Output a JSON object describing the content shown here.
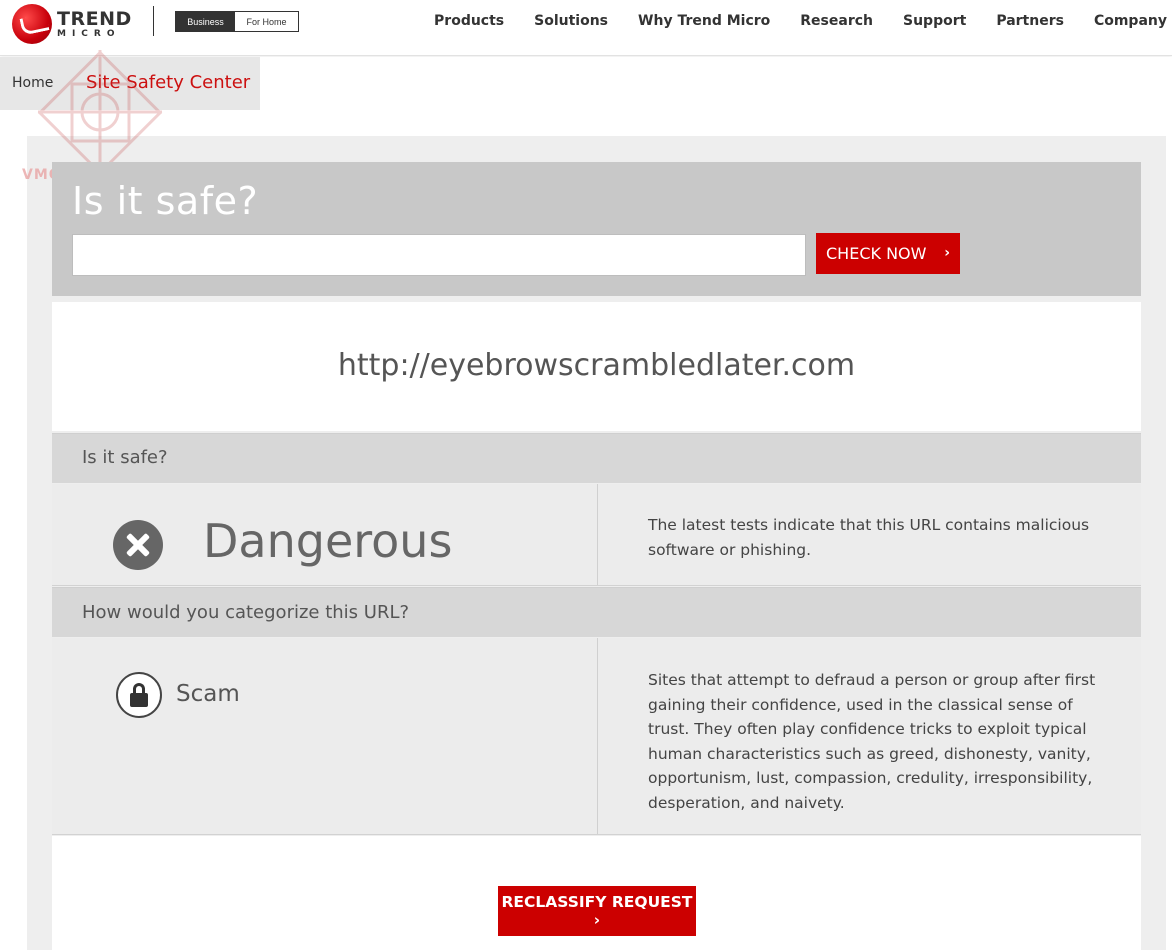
{
  "brand": {
    "word1": "TREND",
    "word2": "MICRO"
  },
  "segment": {
    "business": "Business",
    "home": "For Home"
  },
  "nav": [
    "Products",
    "Solutions",
    "Why Trend Micro",
    "Research",
    "Support",
    "Partners",
    "Company"
  ],
  "breadcrumb": {
    "home": "Home",
    "current": "Site Safety Center"
  },
  "watermark": "VMODTECH.COM",
  "search": {
    "title": "Is it safe?",
    "value": "",
    "button": "CHECK NOW",
    "button_icon": "chevron-right-icon"
  },
  "result": {
    "url": "http://eyebrowscrambledlater.com",
    "safety_header": "Is it safe?",
    "rating": "Dangerous",
    "rating_icon": "x-circle-icon",
    "rating_desc": "The latest tests indicate that this URL contains malicious software or phishing.",
    "category_header": "How would you categorize this URL?",
    "category": "Scam",
    "category_icon": "lock-icon",
    "category_desc": "Sites that attempt to defraud a person or group after first gaining their confidence, used in the classical sense of trust. They often play confidence tricks to exploit typical human characteristics such as greed, dishonesty, vanity, opportunism, lust, compassion, credulity, irresponsibility, desperation, and naivety."
  },
  "reclassify": {
    "label": "RECLASSIFY REQUEST",
    "chevron": "›"
  },
  "colors": {
    "accent": "#cc0000",
    "panel_gray": "#c8c8c8",
    "row_gray": "#ececec"
  }
}
